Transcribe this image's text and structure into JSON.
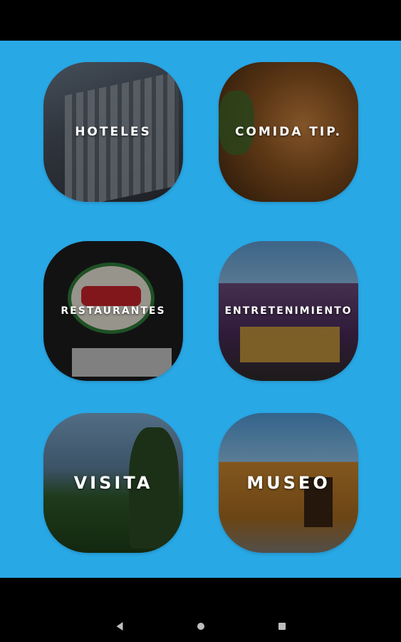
{
  "app": {
    "background_color": "#29a8e6",
    "tiles": [
      {
        "id": "hoteles",
        "label": "HOTELES"
      },
      {
        "id": "comida",
        "label": "COMIDA TIP."
      },
      {
        "id": "restaurantes",
        "label": "RESTAURANTES"
      },
      {
        "id": "entretenimiento",
        "label": "ENTRETENIMIENTO"
      },
      {
        "id": "visita",
        "label": "VISITA"
      },
      {
        "id": "museo",
        "label": "MUSEO"
      }
    ]
  },
  "nav_bar": {
    "back_icon": "back-triangle-icon",
    "home_icon": "home-circle-icon",
    "recents_icon": "recents-square-icon"
  }
}
